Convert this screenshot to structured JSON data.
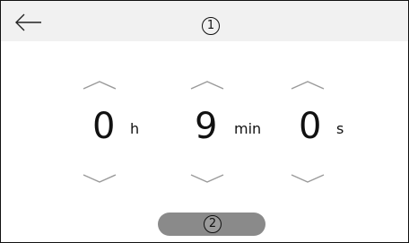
{
  "header": {
    "back_icon": "arrow-left-icon",
    "marker": "1"
  },
  "timer": {
    "columns": [
      {
        "id": "hours",
        "value": "0",
        "unit": "h"
      },
      {
        "id": "minutes",
        "value": "9",
        "unit": "min"
      },
      {
        "id": "seconds",
        "value": "0",
        "unit": "s"
      }
    ],
    "increment_icon": "chevron-up-icon",
    "decrement_icon": "chevron-down-icon"
  },
  "action": {
    "marker": "2",
    "color": "#8a8a8a"
  },
  "colors": {
    "titlebar": "#f1f1f1",
    "chevron": "#9a9a9a",
    "text": "#111111"
  }
}
